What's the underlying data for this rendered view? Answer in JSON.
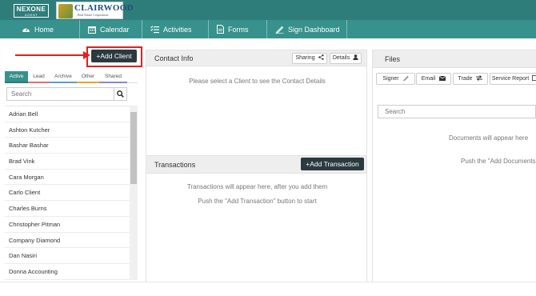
{
  "header": {
    "nexone_logo": "NEXONE",
    "nexone_sub": "AGENT",
    "brand_name": "CLAIRWOOD",
    "brand_sub": "Real Estate Corporation"
  },
  "nav": {
    "items": [
      {
        "label": "Home",
        "icon": "dashboard-icon"
      },
      {
        "label": "Calendar",
        "icon": "calendar-icon"
      },
      {
        "label": "Activities",
        "icon": "checklist-icon"
      },
      {
        "label": "Forms",
        "icon": "document-icon"
      },
      {
        "label": "Sign Dashboard",
        "icon": "pen-icon"
      }
    ]
  },
  "clients": {
    "add_label": "+Add Client",
    "tabs": [
      "Active",
      "Lead",
      "Archive",
      "Other",
      "Shared"
    ],
    "active_tab": "Active",
    "search_placeholder": "Search",
    "list": [
      "Adrian Bell",
      "Ashton Kutcher",
      "Bashar Bashar",
      "Brad Vink",
      "Cara Morgan",
      "Carlo Client",
      "Charles Burns",
      "Christopher Pitman",
      "Company Diamond",
      "Dan Nasiri",
      "Donna Accounting"
    ]
  },
  "contact": {
    "title": "Contact Info",
    "sharing_label": "Sharing",
    "details_label": "Details",
    "placeholder": "Please select a Client to see the Contact Details"
  },
  "transactions": {
    "title": "Transactions",
    "add_label": "+Add Transaction",
    "empty_line1": "Transactions will appear here, after you add them",
    "empty_line2": "Push the \"Add Transaction\" button to start"
  },
  "files": {
    "title": "Files",
    "buttons": [
      "Signer",
      "Email",
      "Trade",
      "Service Report"
    ],
    "search_placeholder": "Search",
    "empty_line1": "Documents will appear here",
    "empty_line2": "Push the \"Add Documents"
  },
  "colors": {
    "topbar": "#2e7d7a",
    "navbar": "#37918c",
    "dark_button": "#2b3a3f",
    "callout_red": "#e02020"
  }
}
